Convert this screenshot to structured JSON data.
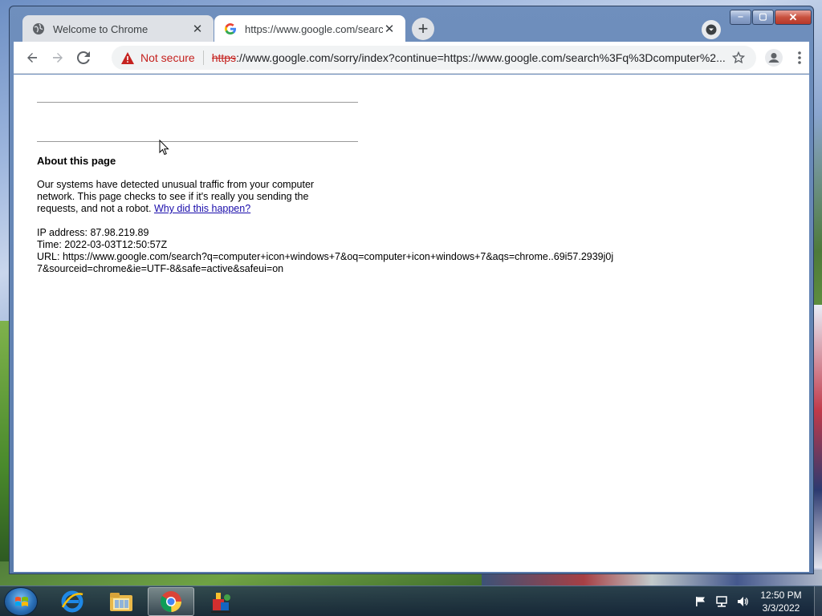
{
  "browser": {
    "tabs": [
      {
        "title": "Welcome to Chrome",
        "icon": "globe-icon",
        "active": false
      },
      {
        "title": "https://www.google.com/search?",
        "icon": "google-icon",
        "active": true
      }
    ],
    "new_tab": "+",
    "security_label": "Not secure",
    "url_scheme": "https",
    "url_rest": "://www.google.com/sorry/index?continue=https://www.google.com/search%3Fq%3Dcomputer%2..."
  },
  "page": {
    "about_title": "About this page",
    "para_text": "Our systems have detected unusual traffic from your computer network. This page checks to see if it's really you sending the requests, and not a robot.",
    "why_link": "Why did this happen?",
    "ip_line": "IP address: 87.98.219.89",
    "time_line": "Time: 2022-03-03T12:50:57Z",
    "url_line": "URL: https://www.google.com/search?q=computer+icon+windows+7&oq=computer+icon+windows+7&aqs=chrome..69i57.2939j0j7&sourceid=chrome&ie=UTF-8&safe=active&safeui=on"
  },
  "taskbar": {
    "apps": [
      "internet-explorer",
      "file-explorer",
      "chrome",
      "paint-app"
    ],
    "time": "12:50 PM",
    "date": "3/3/2022"
  },
  "colors": {
    "not_secure": "#c5221f",
    "link": "#1a0dab"
  }
}
